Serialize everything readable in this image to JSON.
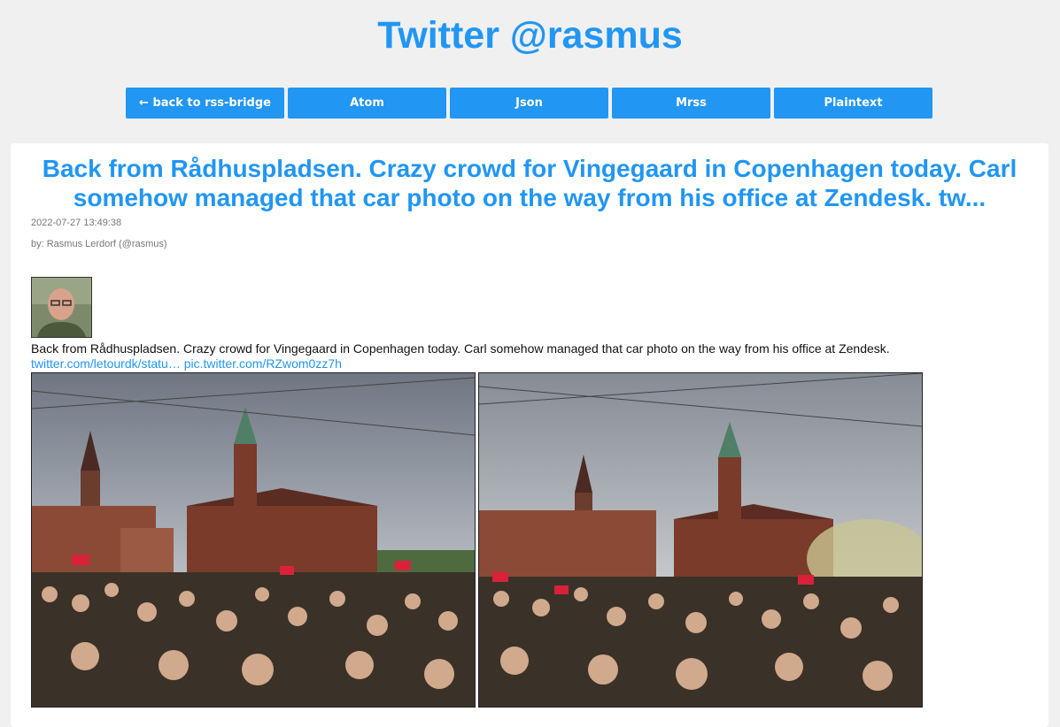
{
  "header": {
    "title": "Twitter @rasmus"
  },
  "nav": [
    {
      "label": "← back to rss-bridge"
    },
    {
      "label": "Atom"
    },
    {
      "label": "Json"
    },
    {
      "label": "Mrss"
    },
    {
      "label": "Plaintext"
    }
  ],
  "post": {
    "title": "Back from Rådhuspladsen. Crazy crowd for Vingegaard in Copenhagen today. Carl somehow managed that car photo on the way from his office at Zendesk. tw...",
    "timestamp": "2022-07-27 13:49:38",
    "author": "by: Rasmus Lerdorf (@rasmus)",
    "body": "Back from Rådhuspladsen. Crazy crowd for Vingegaard in Copenhagen today. Carl somehow managed that car photo on the way from his office at Zendesk.",
    "link1": "twitter.com/letourdk/statu…",
    "link2": "pic.twitter.com/RZwom0zz7h"
  },
  "colors": {
    "accent": "#2196f3",
    "background": "#f0f0f0"
  }
}
